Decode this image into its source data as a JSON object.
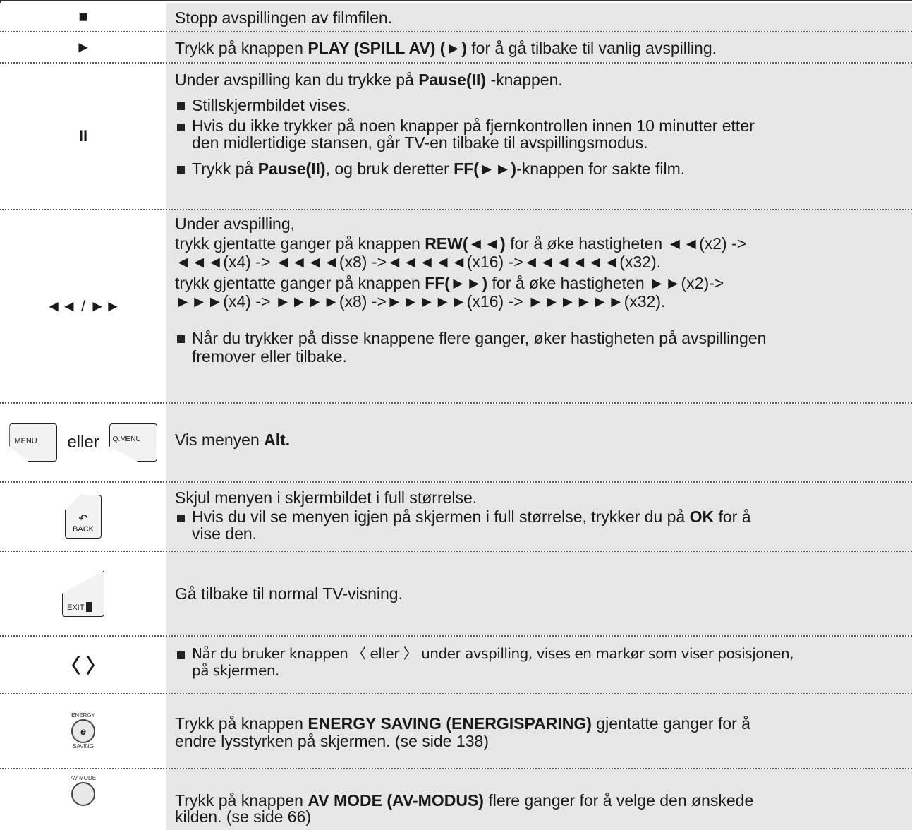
{
  "rows": [
    {
      "key": "■",
      "text": "Stopp avspillingen av filmfilen."
    },
    {
      "key": "►",
      "pre": "Trykk på knappen ",
      "bold": "PLAY (SPILL AV) (►)",
      "post": " for å gå tilbake til vanlig avspilling."
    },
    {
      "key": "II",
      "intro_pre": "Under avspilling kan du trykke på ",
      "intro_bold": "Pause(II)",
      "intro_post": " -knappen.",
      "b1": "Stillskjermbildet vises.",
      "b2_l1": "Hvis du ikke trykker på noen knapper på fjernkontrollen innen 10 minutter etter",
      "b2_l2": "den midlertidige stansen, går TV-en tilbake til avspillingsmodus.",
      "b3_pre": "Trykk på ",
      "b3_bold1": "Pause(II)",
      "b3_mid": ", og bruk deretter ",
      "b3_bold2": "FF(►►)",
      "b3_post": "-knappen for sakte film."
    },
    {
      "key": "◄◄ / ►►",
      "l1": "Under avspilling,",
      "l2_pre": "trykk gjentatte ganger på knappen ",
      "l2_bold": "REW(◄◄)",
      "l2_post": " for å øke hastigheten ◄◄(x2) ->",
      "l3": "◄◄◄(x4) -> ◄◄◄◄(x8) ->◄◄◄◄◄(x16) ->◄◄◄◄◄◄(x32).",
      "l4_pre": "trykk gjentatte ganger på knappen ",
      "l4_bold": "FF(►►)",
      "l4_post": " for å øke hastigheten ►►(x2)->",
      "l5": "►►►(x4) -> ►►►►(x8) ->►►►►►(x16) -> ►►►►►►(x32).",
      "b_l1": "Når du trykker på disse knappene flere ganger, øker hastigheten på avspillingen",
      "b_l2": "fremover eller tilbake."
    },
    {
      "key_menu": "MENU",
      "key_eller": "eller",
      "key_qmenu": "Q.MENU",
      "pre": "Vis menyen ",
      "bold": "Alt."
    },
    {
      "key_label": "BACK",
      "l1": "Skjul menyen i skjermbildet i full størrelse.",
      "b_l1_pre": "Hvis du vil se menyen igjen på skjermen i full størrelse, trykker du på ",
      "b_l1_bold": "OK",
      "b_l1_post": " for å",
      "b_l2": "vise den."
    },
    {
      "key_label": "EXIT",
      "text": "Gå tilbake til normal TV-visning."
    },
    {
      "key": "〈 〉",
      "b_l1": "Når du bruker knappen 〈 eller 〉 under avspilling, vises en markør som viser posisjonen,",
      "b_l2": "på skjermen."
    },
    {
      "key_top": "ENERGY",
      "key_bottom": "SAVING",
      "pre": "Trykk på knappen ",
      "bold": "ENERGY SAVING (ENERGISPARING)",
      "post": " gjentatte ganger for å",
      "l2": "endre lysstyrken på skjermen. (se side 138)"
    },
    {
      "key_top": "AV MODE",
      "pre": "Trykk på knappen ",
      "bold": "AV MODE (AV-MODUS)",
      "post": " flere ganger for å velge den ønskede",
      "l2": "kilden. (se side 66)"
    }
  ]
}
